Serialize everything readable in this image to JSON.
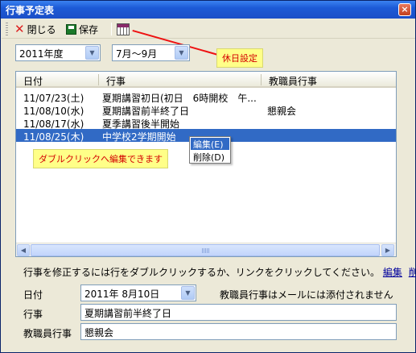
{
  "window": {
    "title": "行事予定表",
    "close_glyph": "×"
  },
  "toolbar": {
    "close_label": "閉じる",
    "save_label": "保存"
  },
  "filters": {
    "year": "2011年度",
    "period": "7月〜9月"
  },
  "holiday_tooltip": "休日設定",
  "list": {
    "columns": [
      "日付",
      "行事",
      "教職員行事"
    ],
    "rows": [
      {
        "date": "11/07/23(土)",
        "event": "夏期講習初日(初日　6時開校　午...",
        "staff": ""
      },
      {
        "date": "11/08/10(水)",
        "event": "夏期講習前半終了日",
        "staff": "懇親会"
      },
      {
        "date": "11/08/17(水)",
        "event": "夏季講習後半開始",
        "staff": ""
      },
      {
        "date": "11/08/25(木)",
        "event": "中学校2学期開始",
        "staff": ""
      }
    ],
    "selected_index": 3
  },
  "dblclick_tooltip": "ダブルクリックへ編集できます",
  "context_menu": {
    "edit": "編集(E)",
    "delete": "削除(D)"
  },
  "help_text": "行事を修正するには行をダブルクリックするか、リンクをクリックしてください。",
  "links": {
    "edit": "編集",
    "delete": "削除"
  },
  "form": {
    "date_label": "日付",
    "date_value": "2011年  8月10日",
    "notice": "教職員行事はメールには添付されません",
    "event_label": "行事",
    "event_value": "夏期講習前半終了日",
    "staff_label": "教職員行事",
    "staff_value": "懇親会"
  }
}
